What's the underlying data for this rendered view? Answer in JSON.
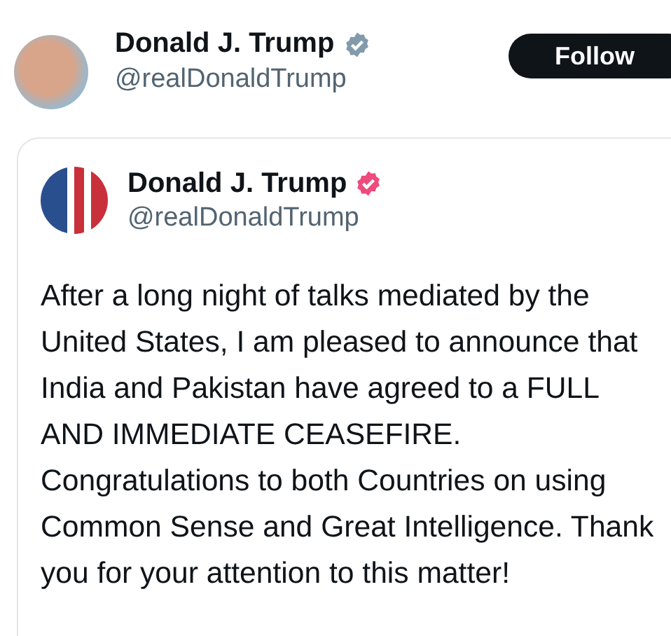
{
  "author": {
    "name": "Donald J. Trump",
    "handle": "@realDonaldTrump",
    "verified": true
  },
  "follow_button": {
    "label": "Follow"
  },
  "quoted_post": {
    "author": {
      "name": "Donald J. Trump",
      "handle": "@realDonaldTrump",
      "verified": true
    },
    "text": "After a long night of talks mediated by the United States, I am pleased to announce that India and Pakistan have agreed to a FULL AND IMMEDIATE CEASEFIRE. Congratulations to both Countries on using Common Sense and Great Intelligence. Thank you for your attention to this matter!"
  }
}
